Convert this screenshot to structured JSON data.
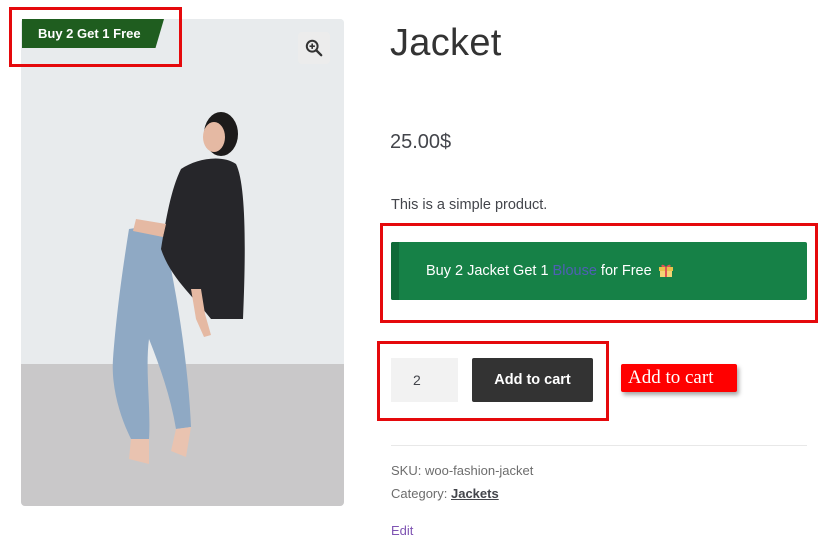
{
  "badge": {
    "label": "Buy 2 Get 1 Free",
    "color": "#1f5d1f"
  },
  "gallery": {
    "zoom_icon": "zoom-in-icon"
  },
  "product": {
    "title": "Jacket",
    "price": "25.00$",
    "description": "This is a simple product."
  },
  "offer": {
    "text_before": "Buy 2 Jacket Get 1 ",
    "link_text": "Blouse",
    "text_after": " for Free",
    "icon": "gift-icon",
    "background": "#168147"
  },
  "cart": {
    "quantity": "2",
    "button_label": "Add to cart"
  },
  "annotation": {
    "callout_label": "Add to cart",
    "color": "#ff0000"
  },
  "meta": {
    "sku_label": "SKU: ",
    "sku_value": "woo-fashion-jacket",
    "category_label": "Category: ",
    "category_value": "Jackets"
  },
  "edit_label": "Edit"
}
